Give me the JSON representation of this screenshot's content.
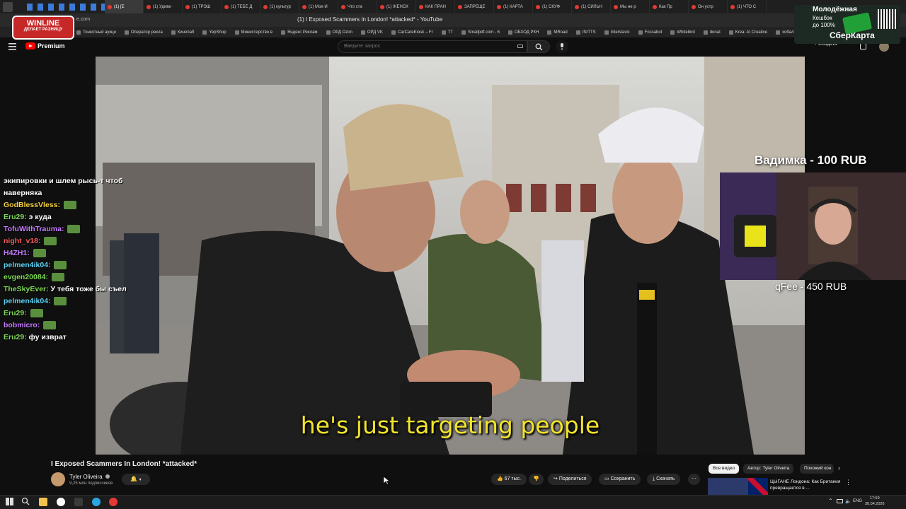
{
  "browser": {
    "tabs": [
      "(1) [E",
      "(1) Удиви",
      "(1) ТРЭШ",
      "(1) ТЕБЕ Д",
      "(1) культур",
      "(1) Моя И",
      "Что ста",
      "(1) ЖЕНСК",
      "КАК ПРАН",
      "ЗАПРЕЩЕ",
      "(1) КАРТА",
      "(1) СКУФ",
      "(1) СИЛЬН",
      "Мы не р",
      "Как Пр",
      "Он устр",
      "(1) ЧТО С"
    ],
    "url_fragment": "e.com",
    "page_title": "(1) I Exposed Scammers In London! *attacked* - YouTube",
    "bookmarks": [
      "Тонкотный аукци",
      "Оператор рекла",
      "Кинопаб",
      "YepShop",
      "Министерство в",
      "Яндекс Реклам",
      "ОРД Ozon",
      "ОРД VK",
      "CarCareKiosk – Fr",
      "TT",
      "Smallpdf.com - 6",
      "ОБХОД РКН",
      "MRoad",
      "/N/TTS",
      "Interslavic",
      "Fossabot",
      "Whitebird",
      "donat",
      "Krea: AI Creative",
      "хобалн"
    ]
  },
  "youtube": {
    "logo_text": "Premium",
    "search_placeholder": "Введите запрос",
    "create_label": "+ Создать"
  },
  "ads": {
    "winline_line1": "WINLINE",
    "winline_line2": "ДЕЛАЕТ РАЗНИЦУ",
    "sber_line1": "Молодёжная",
    "sber_line2": "Кешбэк",
    "sber_line3": "до 100%",
    "sber_line4": "СберКарта"
  },
  "video": {
    "caption": "he's just targeting people",
    "title": "I Exposed Scammers In London! *attacked*",
    "channel": "Tyler Oliveira",
    "subscribers": "9,25 млн подписчиков",
    "likes": "67 тыс.",
    "share_label": "Поделиться",
    "save_label": "Сохранить",
    "download_label": "Скачать"
  },
  "chat": [
    {
      "user": "",
      "color": "#ffffff",
      "text": "экипировки и шлем рысь-т чтоб"
    },
    {
      "user": "",
      "color": "#ffffff",
      "text": "наверняка"
    },
    {
      "user": "GodBlessVless:",
      "color": "#f4d03f",
      "text": ""
    },
    {
      "user": "Eru29:",
      "color": "#7ed957",
      "text": "э куда"
    },
    {
      "user": "TofuWithTrauma:",
      "color": "#c77dff",
      "text": ""
    },
    {
      "user": "night_v18:",
      "color": "#ff5c5c",
      "text": ""
    },
    {
      "user": "H4ZH1:",
      "color": "#c77dff",
      "text": ""
    },
    {
      "user": "pelmen4ik04:",
      "color": "#5fd3f3",
      "text": ""
    },
    {
      "user": "evgen20084:",
      "color": "#7ed957",
      "text": ""
    },
    {
      "user": "TheSkyEver:",
      "color": "#7ed957",
      "text": "У тебя тоже бы съел"
    },
    {
      "user": "pelmen4ik04:",
      "color": "#5fd3f3",
      "text": ""
    },
    {
      "user": "Eru29:",
      "color": "#7ed957",
      "text": ""
    },
    {
      "user": "bobmicro:",
      "color": "#c77dff",
      "text": ""
    },
    {
      "user": "Eru29:",
      "color": "#7ed957",
      "text": "фу изврат"
    }
  ],
  "donations": {
    "top": "Вадимка - 100 RUB",
    "bottom": "qFee - 450 RUB"
  },
  "sidebar": {
    "chips": [
      "Все видео",
      "Автор: Tyler Oliveira",
      "Похожий кон"
    ],
    "rec_title": "ЦЫГАНЕ Лондона: Как Британия превращается в ..."
  },
  "taskbar": {
    "lang": "ENG",
    "time": "17:59",
    "date": "30.04.2026"
  },
  "colors": {
    "caption": "#f2e42b",
    "youtube_red": "#ff0000",
    "winline_red": "#c62828"
  }
}
